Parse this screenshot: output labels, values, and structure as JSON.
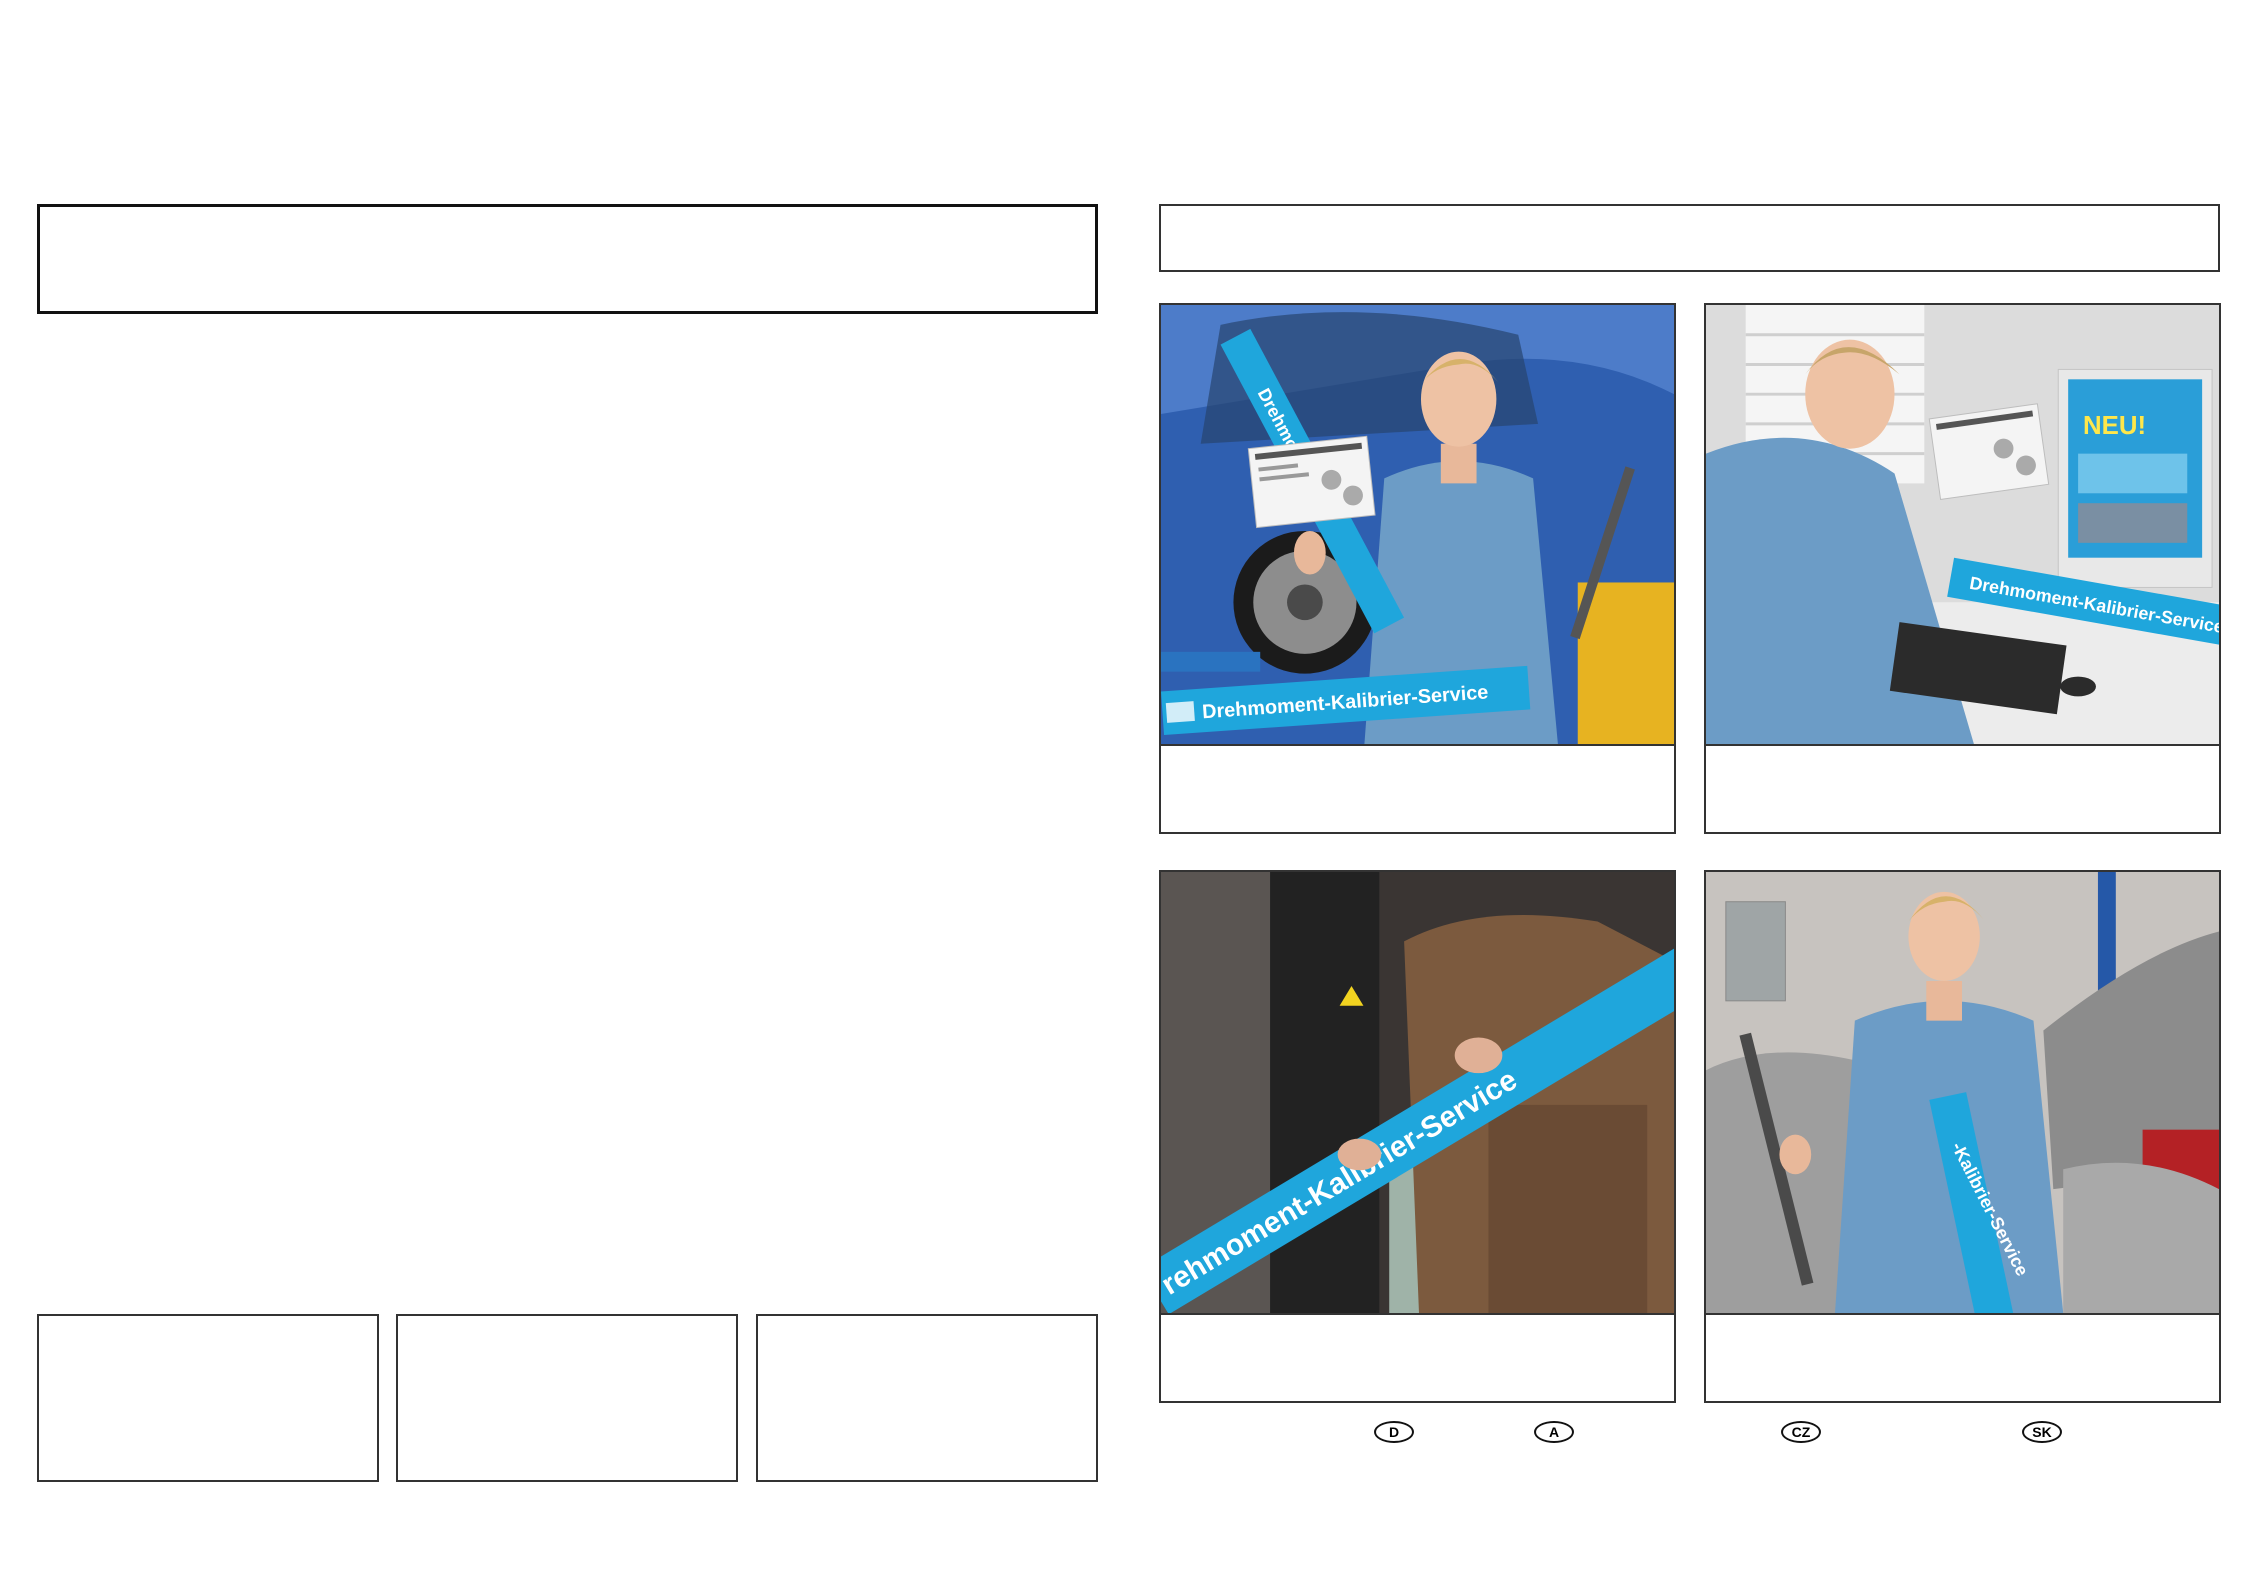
{
  "product": {
    "tube_label": "Drehmoment-Kalibrier-Service",
    "tube_label_cut": "rehmoment-Kalibrier-Service",
    "tube_label_vertical": "-Kalibrier-Service",
    "monitor_badge": "NEU!",
    "colors": {
      "tube": "#1fa6dc",
      "shirt": "#6c9cc6",
      "car": "#1d4fa8"
    }
  },
  "country_badges": [
    "D",
    "A",
    "CZ",
    "SK"
  ]
}
